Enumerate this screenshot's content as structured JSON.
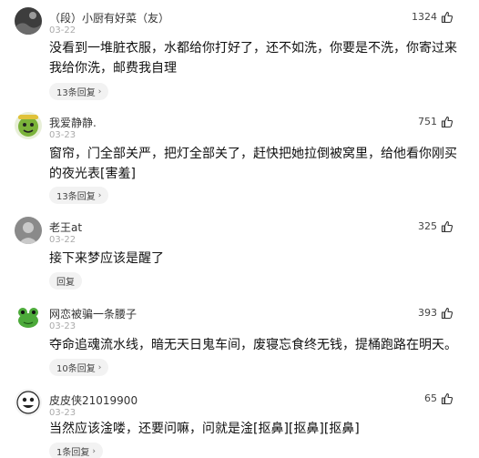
{
  "comments": [
    {
      "username": "（段）小厨有好菜（友）",
      "date": "03-22",
      "likes": "1324",
      "text": "没看到一堆脏衣服，水都给你打好了，还不如洗，你要是不洗，你寄过来我给你洗，邮费我自理",
      "reply": "13条回复",
      "avatar_icon": "dark-avatar-icon"
    },
    {
      "username": "我爱静静.",
      "date": "03-23",
      "likes": "751",
      "text": "窗帘，门全部关严，把灯全部关了，赶快把她拉倒被窝里，给他看你刚买的夜光表[害羞]",
      "reply": "13条回复",
      "avatar_icon": "green-face-avatar-icon"
    },
    {
      "username": "老王at",
      "date": "03-22",
      "likes": "325",
      "text": "接下来梦应该是醒了",
      "reply": "回复",
      "avatar_icon": "grey-avatar-icon"
    },
    {
      "username": "网恋被骗一条腰子",
      "date": "03-23",
      "likes": "393",
      "text": "夺命追魂流水线，暗无天日鬼车间，废寝忘食终无钱，提桶跑路在明天。",
      "reply": "10条回复",
      "avatar_icon": "green-frog-avatar-icon"
    },
    {
      "username": "皮皮侠21019900",
      "date": "03-23",
      "likes": "65",
      "text": "当然应该淦喽，还要问嘛，问就是淦[抠鼻][抠鼻][抠鼻]",
      "reply": "1条回复",
      "avatar_icon": "cartoon-face-avatar-icon"
    }
  ],
  "reply_chevron": "›",
  "colors": {
    "username": "#333333",
    "date": "#aaaaaa",
    "pill_bg": "#f2f2f2"
  }
}
